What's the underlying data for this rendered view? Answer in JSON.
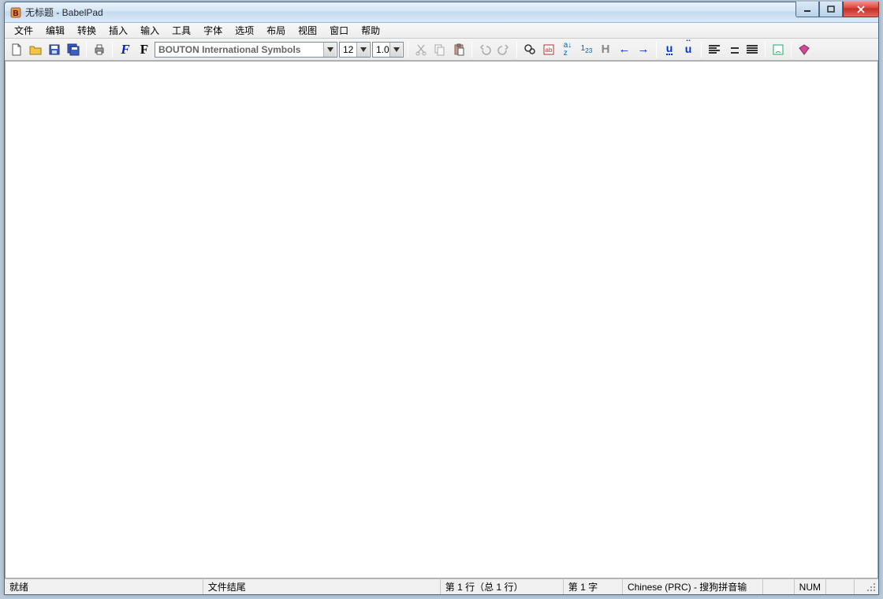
{
  "window": {
    "title": "无标题 - BabelPad"
  },
  "menu": {
    "file": "文件",
    "edit": "编辑",
    "convert": "转换",
    "insert": "插入",
    "input": "输入",
    "tools": "工具",
    "font": "字体",
    "options": "选项",
    "layout": "布局",
    "view": "视图",
    "window": "窗口",
    "help": "帮助"
  },
  "toolbar": {
    "font_name": "BOUTON International Symbols",
    "font_size": "12",
    "line_spacing": "1.0"
  },
  "status": {
    "ready": "就绪",
    "eof": "文件结尾",
    "line": "第 1 行（总 1 行）",
    "char": "第 1 字",
    "ime": "Chinese (PRC) - 搜狗拼音输",
    "num": "NUM"
  }
}
